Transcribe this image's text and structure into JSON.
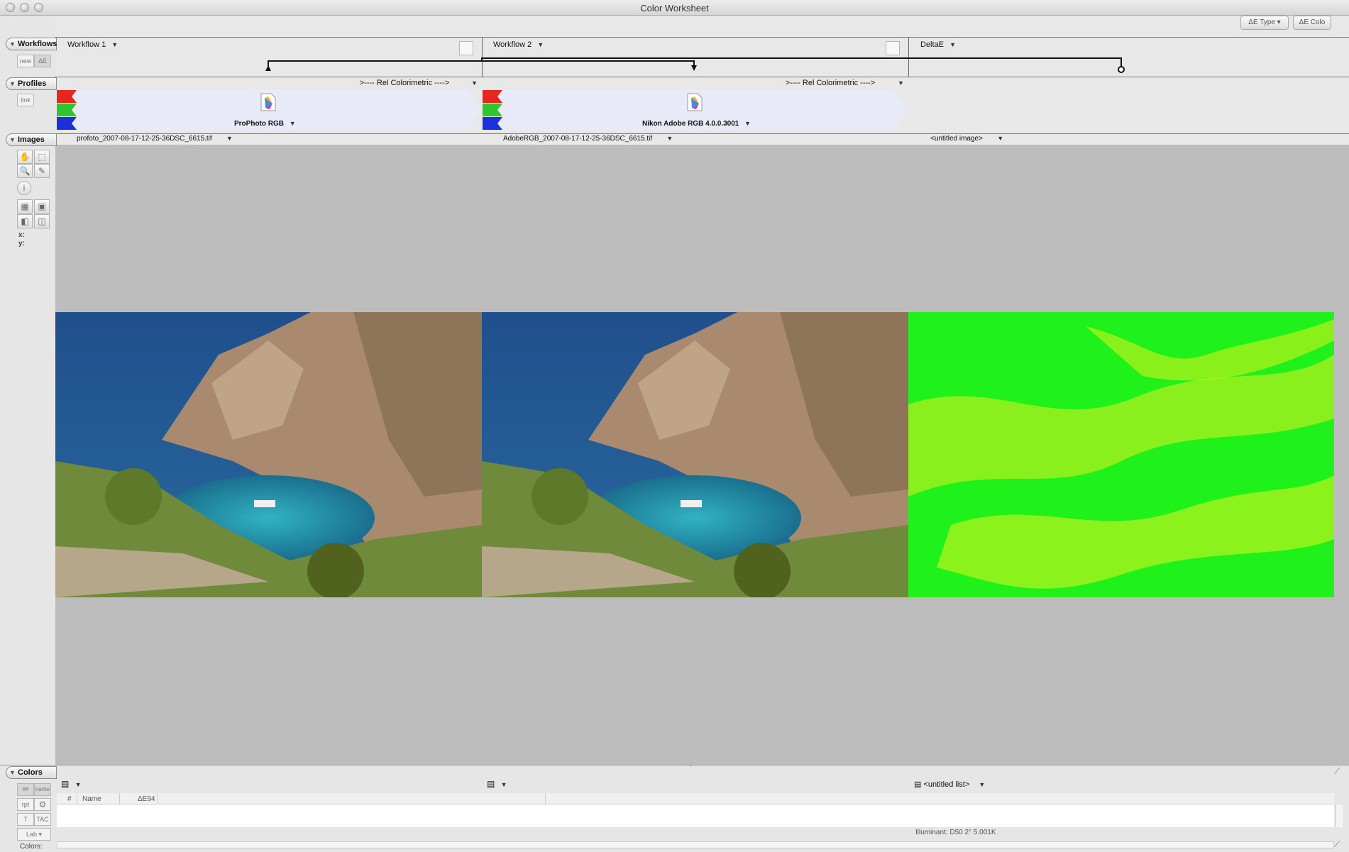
{
  "window": {
    "title": "Color Worksheet"
  },
  "toolbar": {
    "de_type_label": "ΔE Type",
    "de_color_label": "ΔE Colo"
  },
  "sections": {
    "workflows": "Workflows",
    "profiles": "Profiles",
    "images": "Images",
    "colors": "Colors"
  },
  "workflows": {
    "new_label": "new",
    "de_label": "ΔE",
    "items": [
      {
        "label": "Workflow 1"
      },
      {
        "label": "Workflow 2"
      },
      {
        "label": "DeltaE"
      }
    ]
  },
  "profiles": {
    "link_label": "link",
    "intent_1": ">---- Rel Colorimetric ---->",
    "intent_2": ">---- Rel Colorimetric ---->",
    "items": [
      {
        "name": "ProPhoto RGB"
      },
      {
        "name": "Nikon Adobe RGB 4.0.0.3001"
      }
    ]
  },
  "images": {
    "files": [
      {
        "name": "profoto_2007-08-17-12-25-36DSC_6615.tif"
      },
      {
        "name": "AdobeRGB_2007-08-17-12-25-36DSC_6615.tif"
      },
      {
        "name": "<untitled image>"
      }
    ],
    "coord_x": "x:",
    "coord_y": "y:"
  },
  "colors": {
    "list_3": "<untitled list>",
    "rpt_label": "rpt",
    "t_label": "T",
    "tac_label": "TAC",
    "lab_label": "Lab",
    "hash_label": "##",
    "name_label": "name",
    "colors_footer": "Colors:",
    "columns": [
      "#",
      "Name",
      "ΔE94"
    ],
    "illuminant": "Illuminant: D50 2° 5.001K"
  }
}
